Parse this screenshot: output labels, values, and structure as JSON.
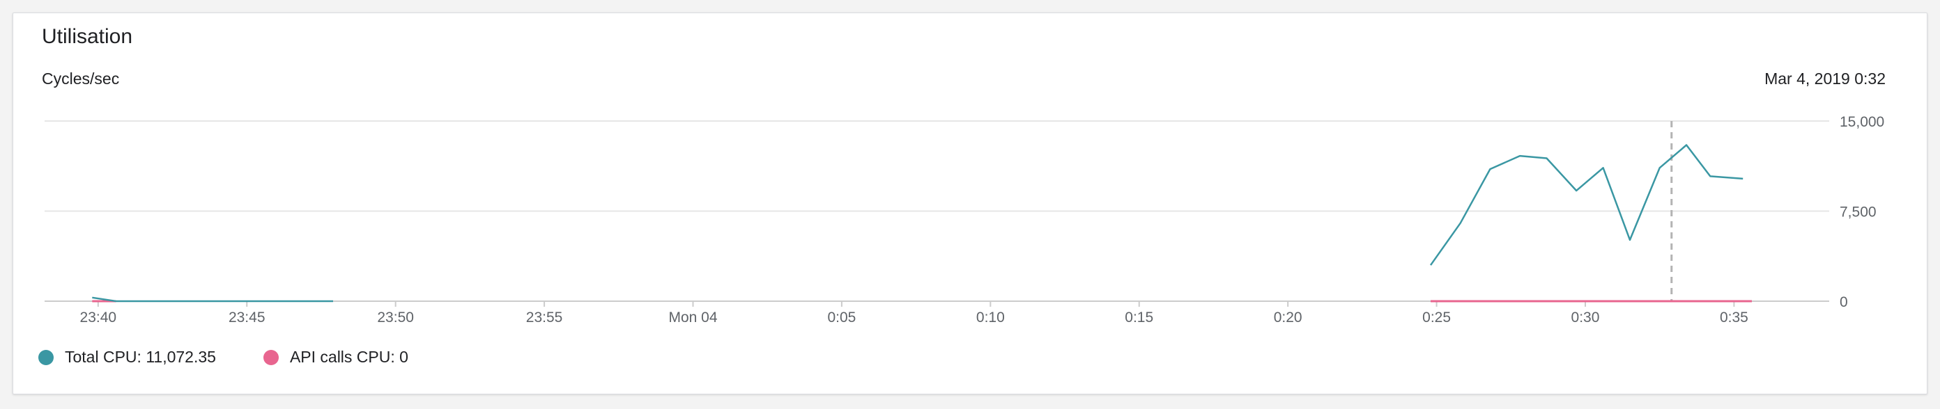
{
  "card": {
    "title": "Utilisation",
    "unit_label": "Cycles/sec",
    "hover_time": "Mar 4, 2019 0:32"
  },
  "colors": {
    "total_cpu": "#3a97a3",
    "api_cpu": "#e8658f",
    "grid": "#e6e6e6",
    "cursor": "#b3b3b3"
  },
  "legend": [
    {
      "label": "Total CPU: 11,072.35",
      "color": "#3a97a3"
    },
    {
      "label": "API calls CPU: 0",
      "color": "#e8658f"
    }
  ],
  "chart_data": {
    "type": "line",
    "ylim": [
      0,
      15000
    ],
    "y_ticks": [
      {
        "value": 0,
        "label": "0"
      },
      {
        "value": 7500,
        "label": "7,500"
      },
      {
        "value": 15000,
        "label": "15,000"
      }
    ],
    "x_ticks": [
      {
        "t": 1420,
        "label": "23:40"
      },
      {
        "t": 1425,
        "label": "23:45"
      },
      {
        "t": 1430,
        "label": "23:50"
      },
      {
        "t": 1435,
        "label": "23:55"
      },
      {
        "t": 1440,
        "label": "Mon 04"
      },
      {
        "t": 1445,
        "label": "0:05"
      },
      {
        "t": 1450,
        "label": "0:10"
      },
      {
        "t": 1455,
        "label": "0:15"
      },
      {
        "t": 1460,
        "label": "0:20"
      },
      {
        "t": 1465,
        "label": "0:25"
      },
      {
        "t": 1470,
        "label": "0:30"
      },
      {
        "t": 1475,
        "label": "0:35"
      }
    ],
    "xlim": [
      1418.2,
      1478.2
    ],
    "cursor_t": 1472.9,
    "series": [
      {
        "key": "total_cpu",
        "segments": [
          {
            "t": [
              1419.8,
              1420.6,
              1421.4,
              1422.3,
              1423.2,
              1424.1,
              1425.0,
              1425.9,
              1426.8,
              1427.7,
              1427.9
            ],
            "y": [
              300,
              0,
              0,
              0,
              0,
              0,
              0,
              0,
              0,
              0,
              0
            ]
          },
          {
            "t": [
              1464.8,
              1465.8,
              1466.8,
              1467.8,
              1468.7,
              1469.7,
              1470.6,
              1471.5,
              1472.5,
              1473.4,
              1474.2,
              1475.3
            ],
            "y": [
              3000,
              6500,
              11000,
              12100,
              11900,
              9200,
              11100,
              5100,
              11100,
              13000,
              10400,
              10200
            ]
          }
        ]
      },
      {
        "key": "api_cpu",
        "segments": [
          {
            "t": [
              1419.8,
              1420.6
            ],
            "y": [
              0,
              0
            ]
          },
          {
            "t": [
              1464.8,
              1475.6
            ],
            "y": [
              0,
              0
            ]
          }
        ]
      }
    ]
  }
}
